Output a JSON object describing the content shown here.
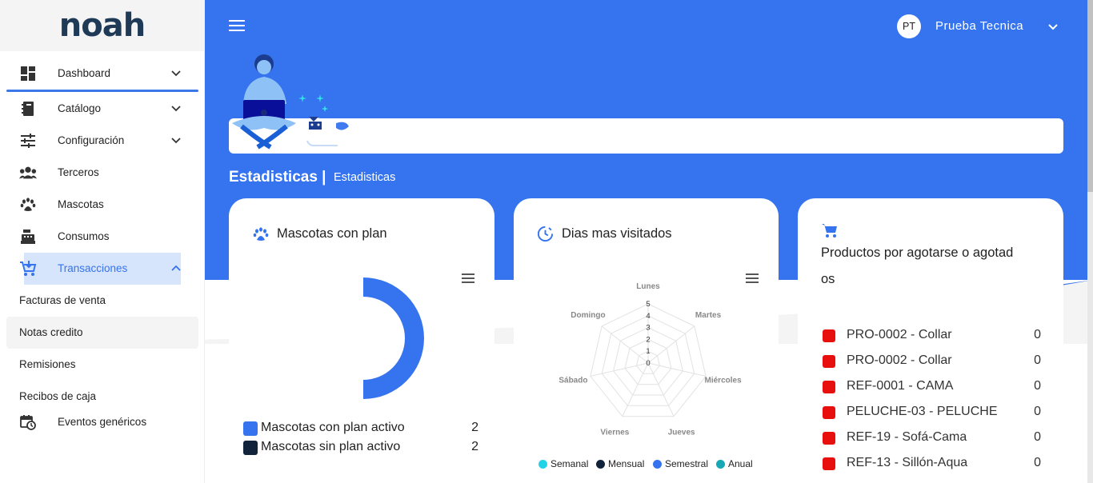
{
  "app": {
    "logo": "noah"
  },
  "sidebar": {
    "items": [
      {
        "label": "Dashboard",
        "icon": "dashboard-icon",
        "expandable": true
      },
      {
        "label": "Catálogo",
        "icon": "catalog-icon",
        "expandable": true
      },
      {
        "label": "Configuración",
        "icon": "tune-icon",
        "expandable": true
      },
      {
        "label": "Terceros",
        "icon": "people-icon",
        "expandable": false
      },
      {
        "label": "Mascotas",
        "icon": "paw-icon",
        "expandable": false
      },
      {
        "label": "Consumos",
        "icon": "cash-register-icon",
        "expandable": false
      },
      {
        "label": "Transacciones",
        "icon": "cart-download-icon",
        "expandable": true,
        "expanded": true
      }
    ],
    "sub_items": [
      "Facturas de venta",
      "Notas credito",
      "Remisiones",
      "Recibos de caja"
    ],
    "extra_item": {
      "label": "Eventos genéricos",
      "icon": "calendar-clock-icon"
    }
  },
  "header": {
    "user_initials": "PT",
    "user_name": "Prueba Tecnica"
  },
  "page": {
    "title": "Estadisticas |",
    "subtitle": "Estadisticas"
  },
  "cards": {
    "pets_plan": {
      "title": "Mascotas con plan",
      "legend": [
        {
          "label": "Mascotas con plan activo",
          "value": "2",
          "color": "#3574ee"
        },
        {
          "label": "Mascotas sin plan activo",
          "value": "2",
          "color": "#10233b"
        }
      ]
    },
    "visited_days": {
      "title": "Dias mas visitados",
      "legend": [
        {
          "label": "Semanal",
          "color": "#22d3e8"
        },
        {
          "label": "Mensual",
          "color": "#10233b"
        },
        {
          "label": "Semestral",
          "color": "#3574ee"
        },
        {
          "label": "Anual",
          "color": "#17a8b5"
        }
      ]
    },
    "products": {
      "title": "Productos por agotarse o agotad",
      "title_line2": "os",
      "items": [
        {
          "label": "PRO-0002 - Collar",
          "value": "0"
        },
        {
          "label": "PRO-0002 - Collar",
          "value": "0"
        },
        {
          "label": "REF-0001 - CAMA",
          "value": "0"
        },
        {
          "label": "PELUCHE-03 - PELUCHE",
          "value": "0"
        },
        {
          "label": "REF-19 - Sofá-Cama",
          "value": "0"
        },
        {
          "label": "REF-13 - Sillón-Aqua",
          "value": "0"
        }
      ]
    }
  },
  "chart_data": [
    {
      "type": "pie",
      "title": "Mascotas con plan",
      "categories": [
        "Mascotas con plan activo",
        "Mascotas sin plan activo"
      ],
      "values": [
        2,
        2
      ],
      "colors": [
        "#3574ee",
        "#10233b"
      ]
    },
    {
      "type": "radar",
      "title": "Dias mas visitados",
      "categories": [
        "Lunes",
        "Martes",
        "Miércoles",
        "Jueves",
        "Viernes",
        "Sábado",
        "Domingo"
      ],
      "ticks": [
        "0",
        "1",
        "2",
        "3",
        "4",
        "5"
      ],
      "rlim": [
        0,
        5
      ],
      "series": [
        {
          "name": "Semanal",
          "values": [
            0,
            0,
            0,
            0,
            0,
            0,
            0
          ]
        },
        {
          "name": "Mensual",
          "values": [
            0,
            0,
            0,
            0,
            0,
            0,
            0
          ]
        },
        {
          "name": "Semestral",
          "values": [
            0,
            0,
            0,
            0,
            0,
            0,
            0
          ]
        },
        {
          "name": "Anual",
          "values": [
            0,
            0,
            0,
            0,
            0,
            0,
            0
          ]
        }
      ],
      "legend_position": "bottom"
    }
  ]
}
